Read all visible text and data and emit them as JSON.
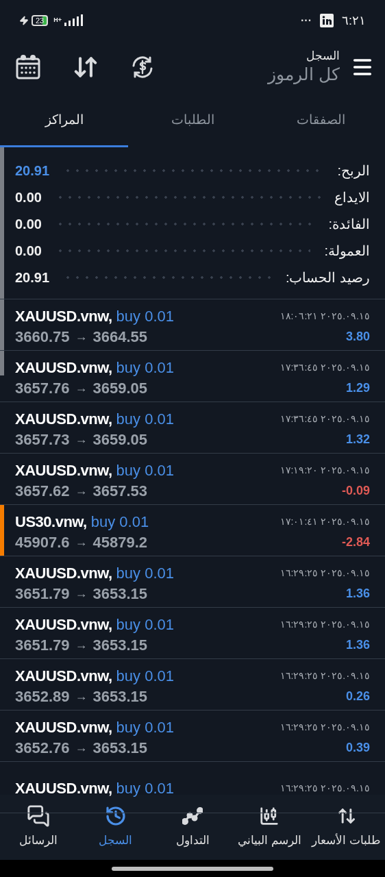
{
  "status_bar": {
    "time": "٦:٢١",
    "more": "···",
    "battery": "23",
    "network": "H+"
  },
  "header": {
    "title": "السجل",
    "subtitle": "كل الرموز"
  },
  "tabs": [
    {
      "label": "الصفقات",
      "selected": false
    },
    {
      "label": "الطلبات",
      "selected": false
    },
    {
      "label": "المراكز",
      "selected": true
    }
  ],
  "summary": [
    {
      "label": "الربح:",
      "value": "20.91",
      "highlight": true
    },
    {
      "label": "الايداع",
      "value": "0.00",
      "highlight": false
    },
    {
      "label": "الفائدة:",
      "value": "0.00",
      "highlight": false
    },
    {
      "label": "العمولة:",
      "value": "0.00",
      "highlight": false
    },
    {
      "label": "رصيد الحساب:",
      "value": "20.91",
      "highlight": false
    }
  ],
  "trades": [
    {
      "symbol": "XAUUSD.vnw,",
      "side": "buy 0.01",
      "open": "3660.75",
      "close": "3664.55",
      "time": "٢٠٢٥.٠٩.١٥ ١٨:٠٦:٢١",
      "profit": "3.80",
      "loss": false
    },
    {
      "symbol": "XAUUSD.vnw,",
      "side": "buy 0.01",
      "open": "3657.76",
      "close": "3659.05",
      "time": "٢٠٢٥.٠٩.١٥ ١٧:٣٦:٤٥",
      "profit": "1.29",
      "loss": false
    },
    {
      "symbol": "XAUUSD.vnw,",
      "side": "buy 0.01",
      "open": "3657.73",
      "close": "3659.05",
      "time": "٢٠٢٥.٠٩.١٥ ١٧:٣٦:٤٥",
      "profit": "1.32",
      "loss": false
    },
    {
      "symbol": "XAUUSD.vnw,",
      "side": "buy 0.01",
      "open": "3657.62",
      "close": "3657.53",
      "time": "٢٠٢٥.٠٩.١٥ ١٧:١٩:٢٠",
      "profit": "-0.09",
      "loss": true
    },
    {
      "symbol": "US30.vnw,",
      "side": "buy 0.01",
      "open": "45907.6",
      "close": "45879.2",
      "time": "٢٠٢٥.٠٩.١٥ ١٧:٠١:٤١",
      "profit": "-2.84",
      "loss": true,
      "color": "#f57c00"
    },
    {
      "symbol": "XAUUSD.vnw,",
      "side": "buy 0.01",
      "open": "3651.79",
      "close": "3653.15",
      "time": "٢٠٢٥.٠٩.١٥ ١٦:٢٩:٢٥",
      "profit": "1.36",
      "loss": false
    },
    {
      "symbol": "XAUUSD.vnw,",
      "side": "buy 0.01",
      "open": "3651.79",
      "close": "3653.15",
      "time": "٢٠٢٥.٠٩.١٥ ١٦:٢٩:٢٥",
      "profit": "1.36",
      "loss": false
    },
    {
      "symbol": "XAUUSD.vnw,",
      "side": "buy 0.01",
      "open": "3652.89",
      "close": "3653.15",
      "time": "٢٠٢٥.٠٩.١٥ ١٦:٢٩:٢٥",
      "profit": "0.26",
      "loss": false
    },
    {
      "symbol": "XAUUSD.vnw,",
      "side": "buy 0.01",
      "open": "3652.76",
      "close": "3653.15",
      "time": "٢٠٢٥.٠٩.١٥ ١٦:٢٩:٢٥",
      "profit": "0.39",
      "loss": false
    },
    {
      "symbol": "XAUUSD.vnw,",
      "side": "buy 0.01",
      "time": "٢٠٢٥.٠٩.١٥ ١٦:٢٩:٢٥"
    }
  ],
  "arrow": "→",
  "bottom_nav": [
    {
      "label": "طلبات الأسعار",
      "kind": "quotes",
      "selected": false
    },
    {
      "label": "الرسم البياني",
      "kind": "chart",
      "selected": false
    },
    {
      "label": "التداول",
      "kind": "trade",
      "selected": false
    },
    {
      "label": "السجل",
      "kind": "history",
      "selected": true
    },
    {
      "label": "الرسائل",
      "kind": "messages",
      "selected": false
    }
  ]
}
